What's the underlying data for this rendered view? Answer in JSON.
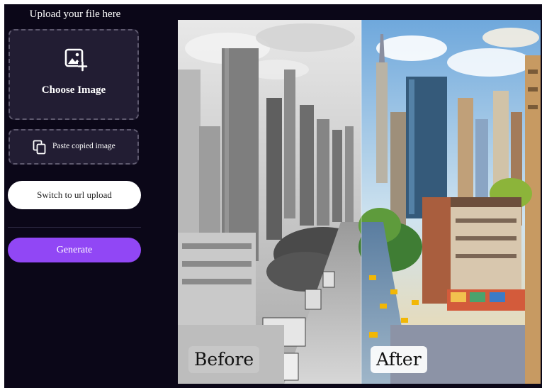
{
  "upload": {
    "heading": "Upload your file here",
    "choose_label": "Choose Image",
    "paste_label": "Paste copied image",
    "url_switch_label": "Switch to url upload",
    "generate_label": "Generate"
  },
  "preview": {
    "before_label": "Before",
    "after_label": "After"
  },
  "colors": {
    "background": "#0b0718",
    "card": "#221d33",
    "accent": "#9147f5"
  }
}
